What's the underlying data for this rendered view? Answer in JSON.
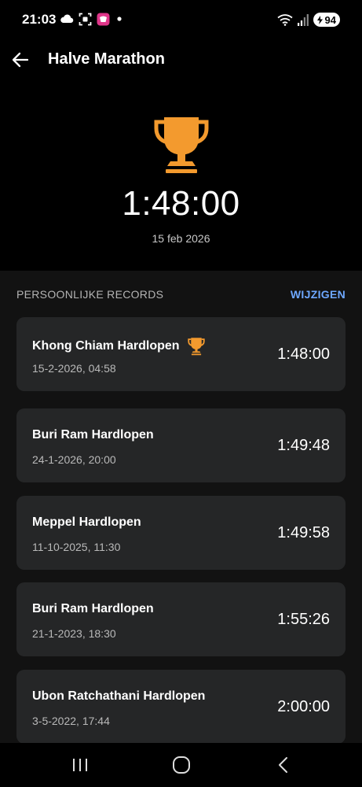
{
  "status_bar": {
    "time": "21:03",
    "battery": "94",
    "icons": [
      "cloud-icon",
      "screenshot-icon",
      "app-notification-icon",
      "dot-icon",
      "wifi-icon",
      "signal-icon",
      "battery-icon"
    ]
  },
  "header": {
    "title": "Halve Marathon",
    "back_icon": "arrow-left-icon"
  },
  "hero": {
    "trophy_icon": "trophy-icon",
    "best_time": "1:48:00",
    "date": "15 feb 2026"
  },
  "records": {
    "section_title": "PERSOONLIJKE RECORDS",
    "edit_label": "WIJZIGEN",
    "items": [
      {
        "name": "Khong Chiam Hardlopen",
        "datetime": "15-2-2026, 04:58",
        "time": "1:48:00",
        "best": true
      },
      {
        "name": "Buri Ram Hardlopen",
        "datetime": "24-1-2026, 20:00",
        "time": "1:49:48",
        "best": false
      },
      {
        "name": "Meppel Hardlopen",
        "datetime": "11-10-2025, 11:30",
        "time": "1:49:58",
        "best": false
      },
      {
        "name": "Buri Ram Hardlopen",
        "datetime": "21-1-2023, 18:30",
        "time": "1:55:26",
        "best": false
      },
      {
        "name": "Ubon Ratchathani Hardlopen",
        "datetime": "3-5-2022, 17:44",
        "time": "2:00:00",
        "best": false
      }
    ]
  },
  "nav": {
    "icons": [
      "recent-apps-icon",
      "home-icon",
      "back-icon"
    ]
  },
  "colors": {
    "background": "#000000",
    "panel": "#121212",
    "card": "#252627",
    "trophy": "#F39A2E",
    "accent": "#6EA8FF"
  }
}
